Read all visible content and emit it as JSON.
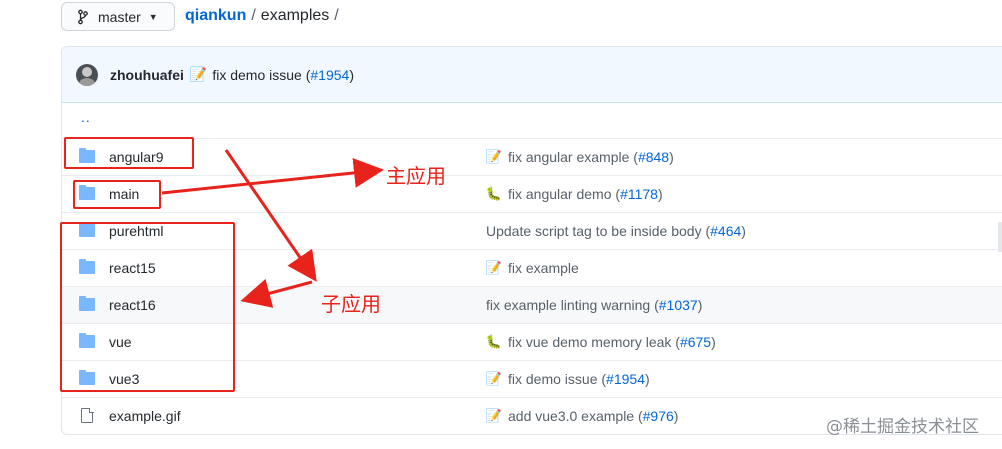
{
  "branch": {
    "label": "master"
  },
  "breadcrumb": {
    "repo": "qiankun",
    "sep1": "/",
    "dir": "examples",
    "sep2": "/"
  },
  "commit": {
    "author": "zhouhuafei",
    "message": "fix demo issue (",
    "pr": "#1954",
    "close": ")"
  },
  "parent_link": "..",
  "rows": [
    {
      "name": "angular9",
      "type": "folder",
      "emoji": "📝",
      "msg": "fix angular example (",
      "pr": "#848",
      "close": ")"
    },
    {
      "name": "main",
      "type": "folder",
      "emoji": "🐛",
      "msg": "fix angular demo (",
      "pr": "#1178",
      "close": ")"
    },
    {
      "name": "purehtml",
      "type": "folder",
      "emoji": "",
      "msg": "Update script tag to be inside body (",
      "pr": "#464",
      "close": ")"
    },
    {
      "name": "react15",
      "type": "folder",
      "emoji": "📝",
      "msg": "fix example",
      "pr": "",
      "close": ""
    },
    {
      "name": "react16",
      "type": "folder",
      "emoji": "",
      "msg": "fix example linting warning (",
      "pr": "#1037",
      "close": ")"
    },
    {
      "name": "vue",
      "type": "folder",
      "emoji": "🐛",
      "msg": "fix vue demo memory leak (",
      "pr": "#675",
      "close": ")"
    },
    {
      "name": "vue3",
      "type": "folder",
      "emoji": "📝",
      "msg": "fix demo issue (",
      "pr": "#1954",
      "close": ")"
    },
    {
      "name": "example.gif",
      "type": "file",
      "emoji": "📝",
      "msg": "add vue3.0 example (",
      "pr": "#976",
      "close": ")"
    }
  ],
  "annotations": {
    "main_app": "主应用",
    "sub_app": "子应用"
  },
  "watermark": "@稀土掘金技术社区",
  "colors": {
    "link": "#0366d6",
    "annotation": "#e8231b",
    "folder": "#79b8ff",
    "header_bg": "#f1f8ff"
  }
}
